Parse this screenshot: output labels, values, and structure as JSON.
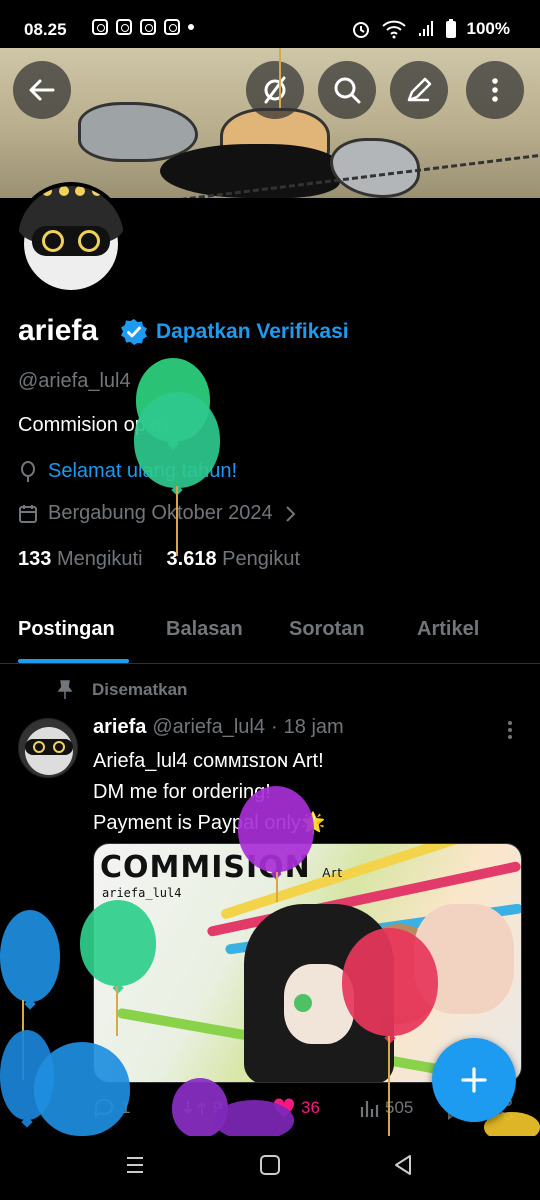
{
  "status_bar": {
    "time": "08.25",
    "battery": "100%"
  },
  "profile": {
    "name": "ariefa",
    "verify_link": "Dapatkan Verifikasi",
    "handle": "@ariefa_lul4",
    "bio": "Commision open",
    "birthday_link": "Selamat ulang tahun!",
    "joined": "Bergabung Oktober 2024",
    "following_count": "133",
    "following_label": "Mengikuti",
    "followers_count": "3.618",
    "followers_label": "Pengikut"
  },
  "tabs": [
    {
      "label": "Postingan"
    },
    {
      "label": "Balasan"
    },
    {
      "label": "Sorotan"
    },
    {
      "label": "Artikel"
    }
  ],
  "post": {
    "pinned_label": "Disematkan",
    "author_name": "ariefa",
    "author_handle": "@ariefa_lul4",
    "separator": "·",
    "time": "18 jam",
    "lines": [
      "Ariefa_lul4 ᴄᴏᴍᴍɪsɪᴏɴ Art!",
      "DM me for ordering!",
      "Payment is Paypal only🌟"
    ],
    "image_title": "COMMISION",
    "image_title_suffix": "Art",
    "image_subtitle": "ariefa_lul4",
    "replies": "1",
    "reposts": "9",
    "likes": "36",
    "views": "505"
  },
  "colors": {
    "accent": "#1d9bf0",
    "like": "#f91880",
    "background": "#000000",
    "muted": "#71767b"
  },
  "icons": [
    "back-arrow-icon",
    "mute-icon",
    "search-icon",
    "edit-icon",
    "more-icon",
    "verified-badge-icon",
    "balloon-icon",
    "calendar-icon",
    "chevron-right-icon",
    "pin-icon",
    "reply-icon",
    "repost-icon",
    "heart-icon",
    "views-icon",
    "bookmark-icon",
    "share-icon",
    "plus-icon"
  ]
}
